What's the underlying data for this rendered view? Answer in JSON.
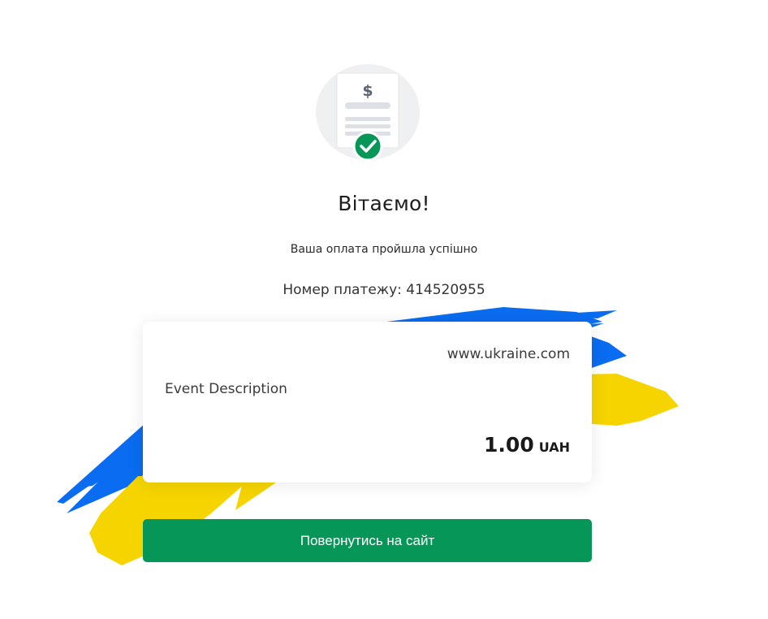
{
  "header": {
    "title": "Вітаємо!",
    "subtitle": "Ваша оплата пройшла успішно",
    "payment_number": "Номер платежу: 414520955"
  },
  "illustration": {
    "icon": "invoice-paid-icon",
    "currency_symbol": "$",
    "check_icon": "check-icon"
  },
  "card": {
    "merchant": "www.ukraine.com",
    "description": "Event Description",
    "amount": "1.00",
    "currency": "UAH"
  },
  "actions": {
    "return_label": "Повернутись на сайт"
  },
  "colors": {
    "primary_green": "#069657",
    "flag_blue": "#0a6cf0",
    "flag_yellow": "#f5d400"
  }
}
